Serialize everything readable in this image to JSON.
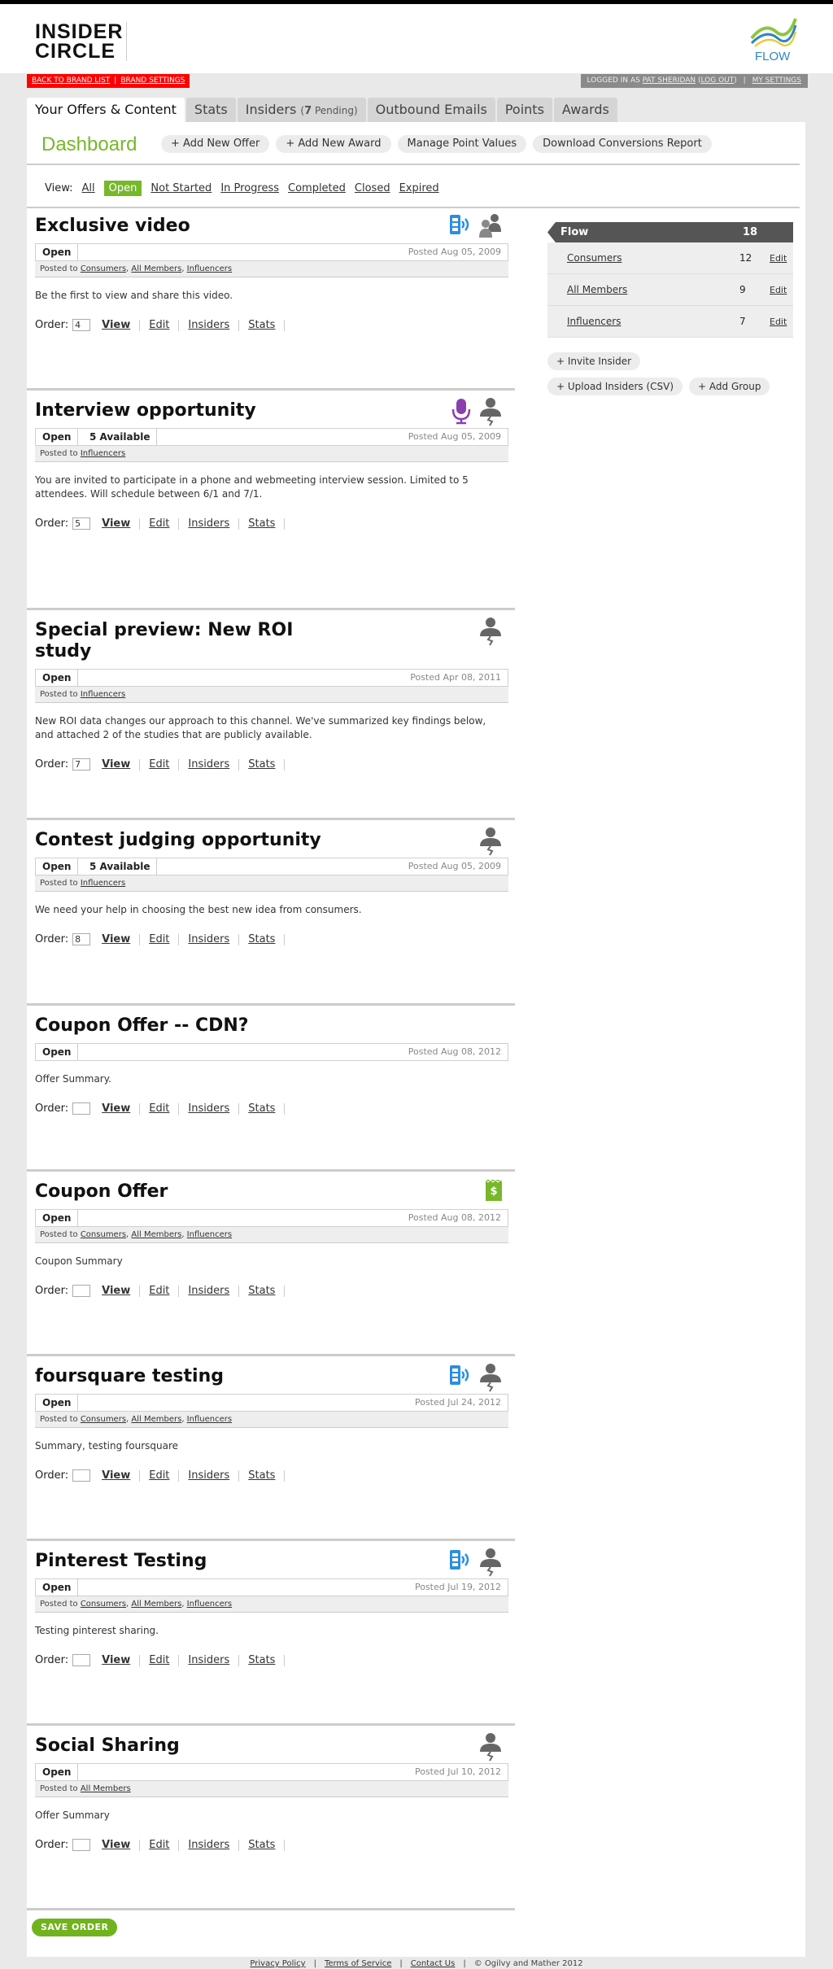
{
  "header": {
    "logo_line1": "INSIDER",
    "logo_line2": "CIRCLE",
    "brand_logo_text": "FLOW",
    "back_link": "BACK TO BRAND LIST",
    "brand_settings": "BRAND SETTINGS",
    "logged_in_prefix": "LOGGED IN AS",
    "user_name": "PAT SHERIDAN",
    "log_out": "LOG OUT",
    "my_settings": "MY SETTINGS"
  },
  "tabs": {
    "offers": "Your Offers & Content",
    "stats": "Stats",
    "insiders": "Insiders",
    "insiders_pending_count": "7",
    "insiders_pending_label": "Pending",
    "outbound": "Outbound Emails",
    "points": "Points",
    "awards": "Awards"
  },
  "dashboard": {
    "title": "Dashboard",
    "actions": [
      "+ Add New Offer",
      "+ Add New Award",
      "Manage Point Values",
      "Download Conversions Report"
    ]
  },
  "view_filter": {
    "label": "View:",
    "options": [
      "All",
      "Open",
      "Not Started",
      "In Progress",
      "Completed",
      "Closed",
      "Expired"
    ],
    "active": "Open"
  },
  "order_labels": {
    "order": "Order:",
    "view": "View",
    "edit": "Edit",
    "insiders": "Insiders",
    "stats": "Stats",
    "posted_to": "Posted to"
  },
  "offers": [
    {
      "title": "Exclusive video",
      "status": "Open",
      "available": "",
      "posted": "Posted Aug 05, 2009",
      "posted_to": [
        "Consumers",
        "All Members",
        "Influencers"
      ],
      "summary": "Be the first to view and share this video.",
      "order": "4",
      "icons": [
        "video-icon",
        "group-icon"
      ]
    },
    {
      "title": "Interview opportunity",
      "status": "Open",
      "available": "5 Available",
      "posted": "Posted Aug 05, 2009",
      "posted_to": [
        "Influencers"
      ],
      "summary": "You are invited to participate in a phone and webmeeting interview session. Limited to 5 attendees. Will schedule between 6/1 and 7/1.",
      "order": "5",
      "icons": [
        "microphone-icon",
        "influencer-icon"
      ]
    },
    {
      "title": "Special preview: New ROI study",
      "status": "Open",
      "available": "",
      "posted": "Posted Apr 08, 2011",
      "posted_to": [
        "Influencers"
      ],
      "summary": "New ROI data changes our approach to this channel. We've summarized key findings below, and attached 2 of the studies that are publicly available.",
      "order": "7",
      "icons": [
        "influencer-icon"
      ]
    },
    {
      "title": "Contest judging opportunity",
      "status": "Open",
      "available": "5 Available",
      "posted": "Posted Aug 05, 2009",
      "posted_to": [
        "Influencers"
      ],
      "summary": "We need your help in choosing the best new idea from consumers.",
      "order": "8",
      "icons": [
        "influencer-icon"
      ]
    },
    {
      "title": "Coupon Offer -- CDN?",
      "status": "Open",
      "available": "",
      "posted": "Posted Aug 08, 2012",
      "posted_to": [],
      "summary": "Offer Summary.",
      "order": "",
      "icons": []
    },
    {
      "title": "Coupon Offer",
      "status": "Open",
      "available": "",
      "posted": "Posted Aug 08, 2012",
      "posted_to": [
        "Consumers",
        "All Members",
        "Influencers"
      ],
      "summary": "Coupon Summary",
      "order": "",
      "icons": [
        "coupon-icon"
      ]
    },
    {
      "title": "foursquare testing",
      "status": "Open",
      "available": "",
      "posted": "Posted Jul 24, 2012",
      "posted_to": [
        "Consumers",
        "All Members",
        "Influencers"
      ],
      "summary": "Summary, testing foursquare",
      "order": "",
      "icons": [
        "video-icon",
        "influencer-icon"
      ]
    },
    {
      "title": "Pinterest Testing",
      "status": "Open",
      "available": "",
      "posted": "Posted Jul 19, 2012",
      "posted_to": [
        "Consumers",
        "All Members",
        "Influencers"
      ],
      "summary": "Testing pinterest sharing.",
      "order": "",
      "icons": [
        "video-icon",
        "influencer-icon"
      ]
    },
    {
      "title": "Social Sharing",
      "status": "Open",
      "available": "",
      "posted": "Posted Jul 10, 2012",
      "posted_to": [
        "All Members"
      ],
      "summary": "Offer Summary",
      "order": "",
      "icons": [
        "influencer-icon"
      ]
    }
  ],
  "save_order": "SAVE ORDER",
  "groups": {
    "title": "Flow",
    "total": "18",
    "edit_label": "Edit",
    "items": [
      {
        "name": "Consumers",
        "count": "12"
      },
      {
        "name": "All Members",
        "count": "9"
      },
      {
        "name": "Influencers",
        "count": "7"
      }
    ],
    "buttons": [
      "+ Invite Insider",
      "+ Upload Insiders (CSV)",
      "+ Add Group"
    ]
  },
  "footer": {
    "links": [
      "Privacy Policy",
      "Terms of Service",
      "Contact Us"
    ],
    "copyright": "© Ogilvy and Mather 2012"
  },
  "colors": {
    "accent_green": "#77b82a",
    "brand_red": "#ff0000",
    "icon_blue": "#2b8fe0",
    "icon_purple": "#8a3fb0",
    "icon_gray": "#666666"
  }
}
